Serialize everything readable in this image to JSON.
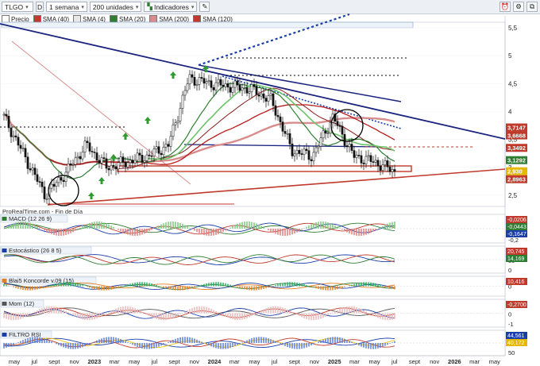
{
  "toolbar": {
    "symbol": "TLGO",
    "flag": "D",
    "period": "1 semana",
    "units": "200 unidades",
    "indicators": "Indicadores"
  },
  "legend": [
    {
      "label": "Precio",
      "color": "#ffffff"
    },
    {
      "label": "SMA (40)",
      "color": "#c0392b"
    },
    {
      "label": "SMA (4)",
      "color": "#e8e8e8"
    },
    {
      "label": "SMA (20)",
      "color": "#2e7d32"
    },
    {
      "label": "SMA (200)",
      "color": "#d98c8c"
    },
    {
      "label": "SMA (120)",
      "color": "#c0392b"
    }
  ],
  "source_label": "ProRealTime.com - Fin de Día",
  "price_axis": {
    "ticks": [
      "5,5",
      "5",
      "4,5",
      "4",
      "3,5",
      "3",
      "2,5"
    ],
    "badges": [
      {
        "text": "3,7147",
        "color": "#c0392b"
      },
      {
        "text": "3,6668",
        "color": "#c0392b"
      },
      {
        "text": "3,3492",
        "color": "#c0392b"
      },
      {
        "text": "3,1292",
        "color": "#2e7d32"
      },
      {
        "text": "2,930",
        "color": "#e6b800"
      },
      {
        "text": "2,8963",
        "color": "#c0392b"
      }
    ]
  },
  "time_axis": [
    "may",
    "jul",
    "sept",
    "nov",
    "2023",
    "mar",
    "may",
    "jul",
    "sept",
    "nov",
    "2024",
    "mar",
    "may",
    "jul",
    "sept",
    "nov",
    "2025",
    "mar",
    "may",
    "jul",
    "sept",
    "nov",
    "2026",
    "mar",
    "may"
  ],
  "panels": [
    {
      "label": "MACD (12 26 9)",
      "ticks": [
        "0,2",
        "0",
        "-0,2"
      ],
      "badges": [
        "-0,0206",
        "-0,0443",
        "-0,1647"
      ]
    },
    {
      "label": "Estocástico (26 8 5)",
      "ticks": [
        "100",
        "50",
        "0"
      ],
      "badges": [
        "20,745",
        "14,169"
      ]
    },
    {
      "label": "Blai5 Koncorde v.09 (15)",
      "ticks": [
        "0"
      ],
      "badges": [
        "10,416"
      ]
    },
    {
      "label": "Mom (12)",
      "ticks": [
        "1",
        "0",
        "-1"
      ],
      "badges": [
        "-0,2700"
      ]
    },
    {
      "label": "FILTRO RSI",
      "ticks": [
        "100",
        "50"
      ],
      "badges": [
        "44,561",
        "40,172"
      ]
    }
  ],
  "chart_data": {
    "type": "candlestick",
    "symbol": "TLGO",
    "period": "1 semana",
    "ylim": [
      2.3,
      5.6
    ],
    "x": [
      "may 2022",
      "jul 2022",
      "sept 2022",
      "nov 2022",
      "2023",
      "mar 2023",
      "may 2023",
      "jul 2023",
      "sept 2023",
      "nov 2023",
      "2024",
      "mar 2024",
      "may 2024",
      "jul 2024",
      "sept 2024",
      "nov 2024",
      "2025",
      "mar 2025",
      "may 2025",
      "jul 2025"
    ],
    "close": [
      3.9,
      3.2,
      2.5,
      2.9,
      3.4,
      3.0,
      3.1,
      3.2,
      3.4,
      4.6,
      4.5,
      4.45,
      4.4,
      4.2,
      3.3,
      3.2,
      3.9,
      3.2,
      3.1,
      2.93
    ],
    "levels": [
      3.7147,
      3.6668,
      3.3492,
      3.1292,
      2.93,
      2.8963
    ]
  }
}
